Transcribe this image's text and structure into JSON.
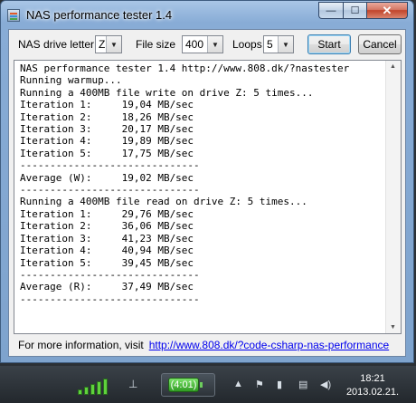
{
  "window": {
    "title": "NAS performance tester 1.4",
    "buttons": {
      "minimize": "—",
      "maximize": "☐",
      "close": "✕"
    }
  },
  "toolbar": {
    "drive_label": "NAS drive letter",
    "drive_value": "Z",
    "filesize_label": "File size",
    "filesize_value": "400",
    "loops_label": "Loops",
    "loops_value": "5",
    "start_label": "Start",
    "cancel_label": "Cancel"
  },
  "output": {
    "lines": [
      "NAS performance tester 1.4 http://www.808.dk/?nastester",
      "Running warmup...",
      "Running a 400MB file write on drive Z: 5 times...",
      "Iteration 1:     19,04 MB/sec",
      "Iteration 2:     18,26 MB/sec",
      "Iteration 3:     20,17 MB/sec",
      "Iteration 4:     19,89 MB/sec",
      "Iteration 5:     17,75 MB/sec",
      "------------------------------",
      "Average (W):     19,02 MB/sec",
      "------------------------------",
      "Running a 400MB file read on drive Z: 5 times...",
      "Iteration 1:     29,76 MB/sec",
      "Iteration 2:     36,06 MB/sec",
      "Iteration 3:     41,23 MB/sec",
      "Iteration 4:     40,94 MB/sec",
      "Iteration 5:     39,45 MB/sec",
      "------------------------------",
      "Average (R):     37,49 MB/sec",
      "------------------------------"
    ]
  },
  "footer": {
    "text": "For more information, visit",
    "link": "http://www.808.dk/?code-csharp-nas-performance"
  },
  "taskbar": {
    "battery_time": "(4:01)",
    "clock_time": "18:21",
    "clock_date": "2013.02.21."
  }
}
